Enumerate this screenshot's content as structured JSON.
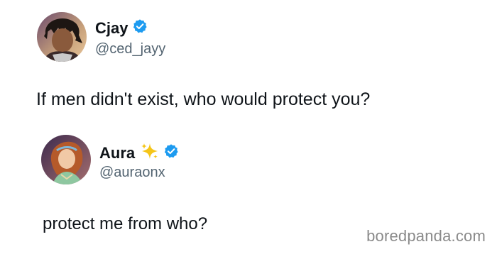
{
  "tweet_main": {
    "display_name": "Cjay",
    "handle": "@ced_jayy",
    "text": "If men didn't exist, who would protect you?",
    "verified_color": "#1d9bf0"
  },
  "tweet_reply": {
    "display_name": "Aura",
    "handle": "@auraonx",
    "text": "protect me from who?",
    "sparkle_icon": "sparkles-icon",
    "verified_color": "#1d9bf0"
  },
  "watermark": {
    "text": "boredpanda.com"
  }
}
